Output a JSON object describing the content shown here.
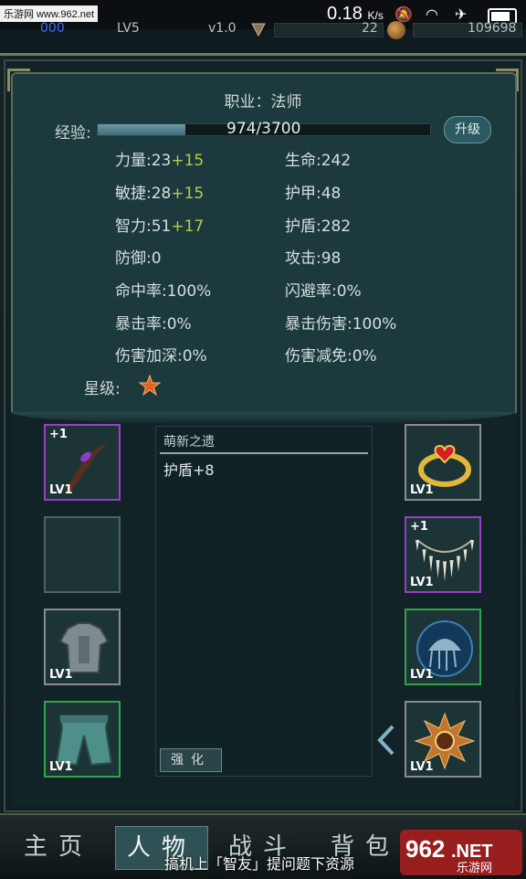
{
  "status_bar": {
    "watermark": "乐游网 www.962.net",
    "net_speed": "0.18",
    "speed_unit": "K/s"
  },
  "resources": {
    "left_num": "000",
    "level": "LV5",
    "version": "v1.0",
    "gems": "22",
    "gold": "109698"
  },
  "profile": {
    "profession": "职业：法师",
    "exp_label": "经验:",
    "exp_value": "974/3700",
    "exp_progress": 0.263,
    "upgrade_label": "升级"
  },
  "stats": {
    "strength": "力量:23",
    "strength_bonus": "+15",
    "agility": "敏捷:28",
    "agility_bonus": "+15",
    "intellect": "智力:51",
    "intellect_bonus": "+17",
    "defense": "防御:0",
    "hp": "生命:242",
    "armor": "护甲:48",
    "shield": "护盾:282",
    "attack": "攻击:98",
    "hit_rate": "命中率:100%",
    "dodge_rate": "闪避率:0%",
    "crit_rate": "暴击率:0%",
    "crit_damage": "暴击伤害:100%",
    "damage_boost": "伤害加深:0%",
    "damage_reduce": "伤害减免:0%",
    "star_label": "星级:"
  },
  "equipment": {
    "left": [
      {
        "bonus": "+1",
        "level": "LV1",
        "icon": "staff-icon"
      },
      {
        "bonus": "",
        "level": "",
        "icon": "empty-slot"
      },
      {
        "bonus": "",
        "level": "LV1",
        "icon": "armor-icon"
      },
      {
        "bonus": "",
        "level": "LV1",
        "icon": "pants-icon"
      }
    ],
    "right": [
      {
        "bonus": "",
        "level": "LV1",
        "icon": "ring-icon"
      },
      {
        "bonus": "+1",
        "level": "LV1",
        "icon": "necklace-icon"
      },
      {
        "bonus": "",
        "level": "LV1",
        "icon": "jellyfish-orb-icon"
      },
      {
        "bonus": "",
        "level": "LV1",
        "icon": "sun-amulet-icon"
      }
    ]
  },
  "item_detail": {
    "title": "萌新之遗",
    "effect": "护盾+8",
    "enhance_label": "强化"
  },
  "nav": {
    "home": "主页",
    "character": "人物",
    "battle": "战斗",
    "bag": "背包"
  },
  "caption": "搞机上「智友」提问题下资源",
  "logo": {
    "main": "962",
    "sub": "乐游网",
    "suffix": ".NET"
  },
  "colors": {
    "bonus_text": "#b9c94a",
    "purple_border": "#9b3cc9",
    "green_border": "#2fa34a"
  }
}
